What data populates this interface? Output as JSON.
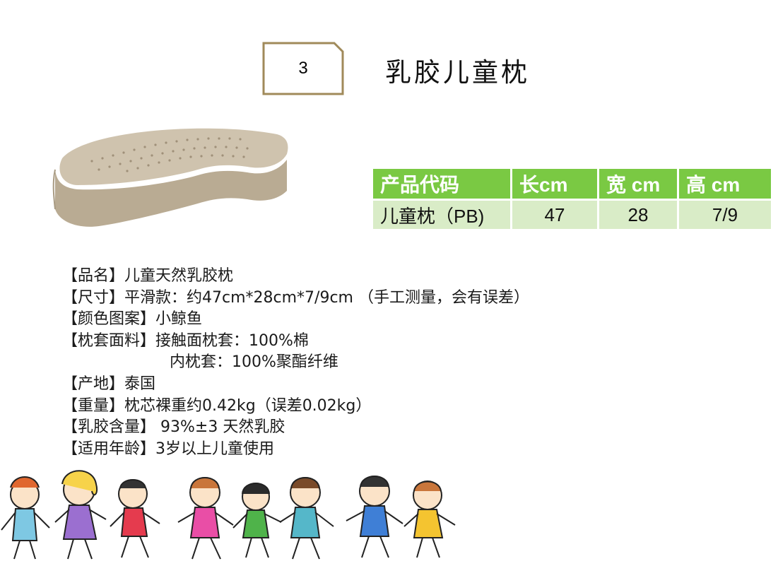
{
  "header": {
    "number": "3",
    "title": "乳胶儿童枕"
  },
  "product_image": {
    "icon": "latex-pillow-image"
  },
  "table": {
    "headers": [
      "产品代码",
      "长cm",
      "宽 cm",
      "高 cm"
    ],
    "rows": [
      [
        "儿童枕（PB)",
        "47",
        "28",
        "7/9"
      ]
    ]
  },
  "info": {
    "lines": [
      "【品名】儿童天然乳胶枕",
      "【尺寸】平滑款：约47cm*28cm*7/9cm （手工测量，会有误差）",
      "【颜色图案】小鲸鱼",
      "【枕套面料】接触面枕套：100%棉",
      "内枕套：100%聚酯纤维",
      "【产地】泰国",
      "【重量】枕芯裸重约0.42kg（误差0.02kg）",
      "【乳胶含量】 93%±3 天然乳胶",
      "【适用年龄】3岁以上儿童使用"
    ]
  },
  "decoration": {
    "icon": "dancing-children-illustration"
  },
  "colors": {
    "header_green": "#7ac943",
    "row_green": "#d9ecc7",
    "badge_border": "#a08a5a",
    "pillow": "#c8bba6"
  }
}
